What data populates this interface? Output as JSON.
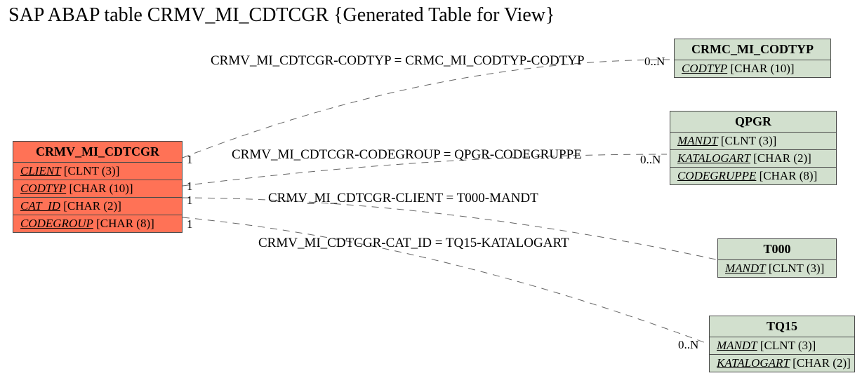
{
  "title": "SAP ABAP table CRMV_MI_CDTCGR {Generated Table for View}",
  "entities": {
    "main": {
      "name": "CRMV_MI_CDTCGR",
      "fields": [
        {
          "fk": "CLIENT",
          "type": "[CLNT (3)]"
        },
        {
          "fk": "CODTYP",
          "type": "[CHAR (10)]"
        },
        {
          "fk": "CAT_ID",
          "type": "[CHAR (2)]"
        },
        {
          "fk": "CODEGROUP",
          "type": "[CHAR (8)]"
        }
      ]
    },
    "r0": {
      "name": "CRMC_MI_CODTYP",
      "fields": [
        {
          "fk": "CODTYP",
          "type": "[CHAR (10)]"
        }
      ]
    },
    "r1": {
      "name": "QPGR",
      "fields": [
        {
          "fk": "MANDT",
          "type": "[CLNT (3)]"
        },
        {
          "fk": "KATALOGART",
          "type": "[CHAR (2)]"
        },
        {
          "fk": "CODEGRUPPE",
          "type": "[CHAR (8)]"
        }
      ]
    },
    "r2": {
      "name": "T000",
      "fields": [
        {
          "fk": "MANDT",
          "type": "[CLNT (3)]"
        }
      ]
    },
    "r3": {
      "name": "TQ15",
      "fields": [
        {
          "fk": "MANDT",
          "type": "[CLNT (3)]"
        },
        {
          "fk": "KATALOGART",
          "type": "[CHAR (2)]"
        }
      ]
    }
  },
  "rels": {
    "a": {
      "label": "CRMV_MI_CDTCGR-CODTYP = CRMC_MI_CODTYP-CODTYP",
      "left": "1",
      "right": "0..N"
    },
    "b": {
      "label": "CRMV_MI_CDTCGR-CODEGROUP = QPGR-CODEGRUPPE",
      "left": "1",
      "right": "0..N"
    },
    "c": {
      "label": "CRMV_MI_CDTCGR-CLIENT = T000-MANDT",
      "left": "1",
      "right": ""
    },
    "d": {
      "label": "CRMV_MI_CDTCGR-CAT_ID = TQ15-KATALOGART",
      "left": "1",
      "right": "0..N"
    }
  },
  "chart_data": {
    "type": "erd",
    "tables": [
      {
        "name": "CRMV_MI_CDTCGR",
        "role": "view",
        "columns": [
          {
            "name": "CLIENT",
            "type": "CLNT",
            "len": 3,
            "fk": true
          },
          {
            "name": "CODTYP",
            "type": "CHAR",
            "len": 10,
            "fk": true
          },
          {
            "name": "CAT_ID",
            "type": "CHAR",
            "len": 2,
            "fk": true
          },
          {
            "name": "CODEGROUP",
            "type": "CHAR",
            "len": 8,
            "fk": true
          }
        ]
      },
      {
        "name": "CRMC_MI_CODTYP",
        "columns": [
          {
            "name": "CODTYP",
            "type": "CHAR",
            "len": 10,
            "fk": true
          }
        ]
      },
      {
        "name": "QPGR",
        "columns": [
          {
            "name": "MANDT",
            "type": "CLNT",
            "len": 3,
            "fk": true
          },
          {
            "name": "KATALOGART",
            "type": "CHAR",
            "len": 2,
            "fk": true
          },
          {
            "name": "CODEGRUPPE",
            "type": "CHAR",
            "len": 8,
            "fk": true
          }
        ]
      },
      {
        "name": "T000",
        "columns": [
          {
            "name": "MANDT",
            "type": "CLNT",
            "len": 3,
            "fk": true
          }
        ]
      },
      {
        "name": "TQ15",
        "columns": [
          {
            "name": "MANDT",
            "type": "CLNT",
            "len": 3,
            "fk": true
          },
          {
            "name": "KATALOGART",
            "type": "CHAR",
            "len": 2,
            "fk": true
          }
        ]
      }
    ],
    "relations": [
      {
        "from": "CRMV_MI_CDTCGR.CODTYP",
        "to": "CRMC_MI_CODTYP.CODTYP",
        "card_from": "1",
        "card_to": "0..N"
      },
      {
        "from": "CRMV_MI_CDTCGR.CODEGROUP",
        "to": "QPGR.CODEGRUPPE",
        "card_from": "1",
        "card_to": "0..N"
      },
      {
        "from": "CRMV_MI_CDTCGR.CLIENT",
        "to": "T000.MANDT",
        "card_from": "1",
        "card_to": ""
      },
      {
        "from": "CRMV_MI_CDTCGR.CAT_ID",
        "to": "TQ15.KATALOGART",
        "card_from": "1",
        "card_to": "0..N"
      }
    ]
  }
}
